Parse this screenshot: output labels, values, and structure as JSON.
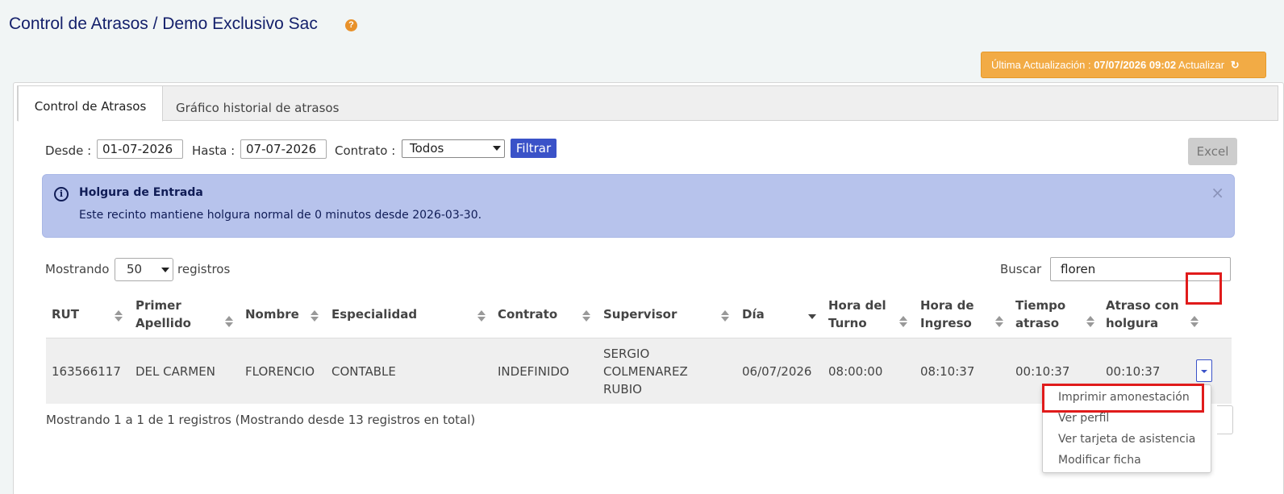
{
  "header": {
    "title": "Control de Atrasos / Demo Exclusivo Sac",
    "help_glyph": "?"
  },
  "update": {
    "label": "Última Actualización :",
    "datetime": "07/07/2026 09:02",
    "action": "Actualizar",
    "color": "#f2ab45"
  },
  "tabs": [
    {
      "label": "Control de Atrasos",
      "active": true
    },
    {
      "label": "Gráfico historial de atrasos",
      "active": false
    }
  ],
  "filters": {
    "desde_label": "Desde :",
    "desde_value": "01-07-2026",
    "hasta_label": "Hasta :",
    "hasta_value": "07-07-2026",
    "contrato_label": "Contrato :",
    "contrato_value": "Todos",
    "filter_button": "Filtrar",
    "excel_button": "Excel"
  },
  "alert": {
    "title": "Holgura de Entrada",
    "text": "Este recinto mantiene holgura normal de 0 minutos desde 2026-03-30.",
    "close": "×",
    "info_glyph": "i",
    "background": "#b7c3ec"
  },
  "table_controls": {
    "showing_label": "Mostrando",
    "page_size": "50",
    "records_label": "registros",
    "search_label": "Buscar",
    "search_value": "floren"
  },
  "table": {
    "columns": [
      {
        "l1": "RUT",
        "l2": ""
      },
      {
        "l1": "Primer",
        "l2": "Apellido"
      },
      {
        "l1": "Nombre",
        "l2": ""
      },
      {
        "l1": "Especialidad",
        "l2": ""
      },
      {
        "l1": "Contrato",
        "l2": ""
      },
      {
        "l1": "Supervisor",
        "l2": ""
      },
      {
        "l1": "Día",
        "l2": ""
      },
      {
        "l1": "Hora del",
        "l2": "Turno"
      },
      {
        "l1": "Hora de",
        "l2": "Ingreso"
      },
      {
        "l1": "Tiempo",
        "l2": "atraso"
      },
      {
        "l1": "Atraso con",
        "l2": "holgura"
      }
    ],
    "rows": [
      {
        "rut": "163566117",
        "primer_apellido": "DEL CARMEN",
        "nombre": "FLORENCIO",
        "especialidad": "CONTABLE",
        "contrato": "INDEFINIDO",
        "supervisor": [
          "SERGIO",
          "COLMENAREZ",
          "RUBIO"
        ],
        "dia": "06/07/2026",
        "hora_turno": "08:00:00",
        "hora_ingreso": "08:10:37",
        "tiempo_atraso": "00:10:37",
        "atraso_holgura": "00:10:37"
      }
    ],
    "info": "Mostrando 1 a 1 de 1 registros (Mostrando desde 13 registros en total)"
  },
  "row_menu": {
    "items": [
      "Imprimir amonestación",
      "Ver perfil",
      "Ver tarjeta de asistencia",
      "Modificar ficha"
    ]
  },
  "icons": {
    "help": "help-circle-icon",
    "refresh": "refresh-icon",
    "info": "info-circle-icon",
    "close": "close-icon",
    "sort": "sort-icon",
    "dropdown": "caret-down-icon"
  },
  "accent": "#3a52c8",
  "highlight": "#e01b1b"
}
